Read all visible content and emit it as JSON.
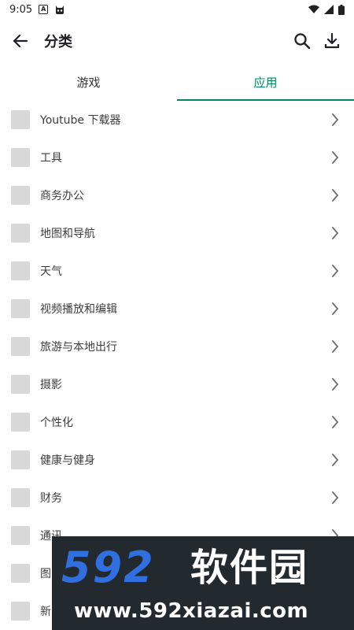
{
  "status_bar": {
    "time": "9:05",
    "left_icons": [
      "notification-a-icon",
      "robot-face-icon"
    ],
    "right_icons": [
      "wifi-icon",
      "signal-icon",
      "battery-icon"
    ]
  },
  "app_bar": {
    "title": "分类",
    "back_icon": "arrow-left-icon",
    "actions": [
      "search-icon",
      "download-icon"
    ]
  },
  "tabs": [
    {
      "label": "游戏",
      "active": false
    },
    {
      "label": "应用",
      "active": true
    }
  ],
  "accent_color": "#01875f",
  "categories": [
    "Youtube 下载器",
    "工具",
    "商务办公",
    "地图和导航",
    "天气",
    "视频播放和编辑",
    "旅游与本地出行",
    "摄影",
    "个性化",
    "健康与健身",
    "财务",
    "通讯",
    "图",
    "新"
  ],
  "watermark": {
    "logo_number": "592",
    "logo_text": "软件园",
    "url": "www.592xiazai.com"
  }
}
